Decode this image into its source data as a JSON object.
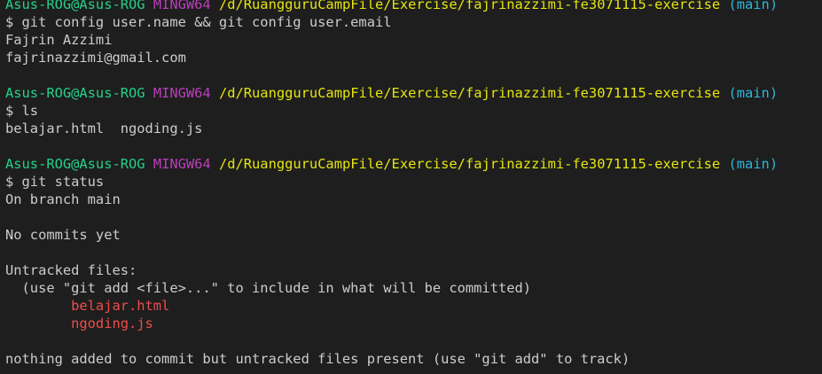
{
  "terminal": {
    "prev_prompt": {
      "user_host": "Asus-ROG@Asus-ROG",
      "shell": "MINGW64",
      "path": "/d/RuangguruCampFile/Exercise/fajrinazzimi-fe3071115-exercise",
      "branch": "(main)"
    },
    "cmd1": "$ git config user.name && git config user.email",
    "out_name": "Fajrin Azzimi",
    "out_email": "fajrinazzimi@gmail.com",
    "prompt2": {
      "user_host": "Asus-ROG@Asus-ROG",
      "shell": "MINGW64",
      "path": "/d/RuangguruCampFile/Exercise/fajrinazzimi-fe3071115-exercise",
      "branch": "(main)"
    },
    "cmd2": "$ ls",
    "ls_output": "belajar.html  ngoding.js",
    "prompt3": {
      "user_host": "Asus-ROG@Asus-ROG",
      "shell": "MINGW64",
      "path": "/d/RuangguruCampFile/Exercise/fajrinazzimi-fe3071115-exercise",
      "branch": "(main)"
    },
    "cmd3": "$ git status",
    "status": {
      "branch_line": "On branch main",
      "no_commits": "No commits yet",
      "untracked_header": "Untracked files:",
      "untracked_hint": "  (use \"git add <file>...\" to include in what will be committed)",
      "files": [
        "        belajar.html",
        "        ngoding.js"
      ],
      "summary": "nothing added to commit but untracked files present (use \"git add\" to track)"
    }
  },
  "colors": {
    "background": "#1e1e1e",
    "foreground": "#cccccc",
    "user_host": "#23d18b",
    "shell": "#bc3fbc",
    "path": "#e5e510",
    "branch": "#29b8db",
    "untracked_file": "#f14c4c"
  }
}
